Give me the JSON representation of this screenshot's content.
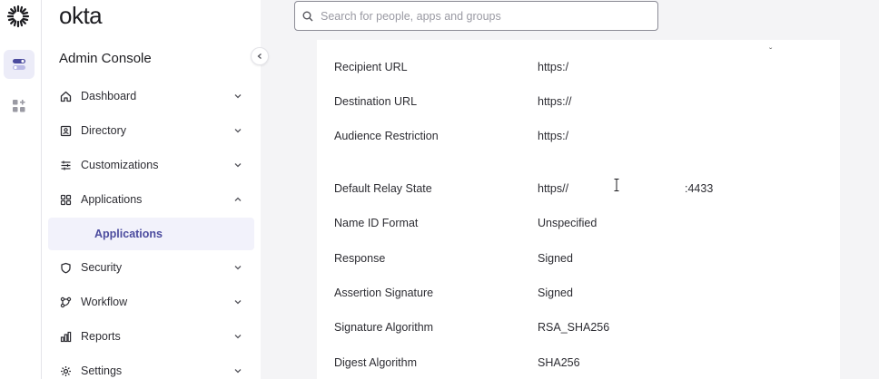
{
  "brand": {
    "name": "okta"
  },
  "sidebar": {
    "title": "Admin Console",
    "items": [
      {
        "label": "Dashboard",
        "icon": "home-icon"
      },
      {
        "label": "Directory",
        "icon": "directory-icon"
      },
      {
        "label": "Customizations",
        "icon": "sliders-icon"
      },
      {
        "label": "Applications",
        "icon": "apps-grid-icon",
        "expanded": true
      },
      {
        "label": "Security",
        "icon": "shield-icon"
      },
      {
        "label": "Workflow",
        "icon": "workflow-icon"
      },
      {
        "label": "Reports",
        "icon": "chart-icon"
      },
      {
        "label": "Settings",
        "icon": "gear-icon"
      }
    ],
    "subitem": "Applications"
  },
  "search": {
    "placeholder": "Search for people, apps and groups"
  },
  "details": [
    {
      "label": "Recipient URL",
      "value": "https:/"
    },
    {
      "label": "Destination URL",
      "value": "https://"
    },
    {
      "label": "Audience Restriction",
      "value": "https:/"
    },
    {
      "label": "Default Relay State",
      "value": "https//",
      "extra": ":4433"
    },
    {
      "label": "Name ID Format",
      "value": "Unspecified"
    },
    {
      "label": "Response",
      "value": "Signed"
    },
    {
      "label": "Assertion Signature",
      "value": "Signed"
    },
    {
      "label": "Signature Algorithm",
      "value": "RSA_SHA256"
    },
    {
      "label": "Digest Algorithm",
      "value": "SHA256"
    }
  ],
  "colors": {
    "accent": "#4b4b9e",
    "active_bg": "#f2f2fb",
    "main_bg": "#f4f4f6"
  }
}
